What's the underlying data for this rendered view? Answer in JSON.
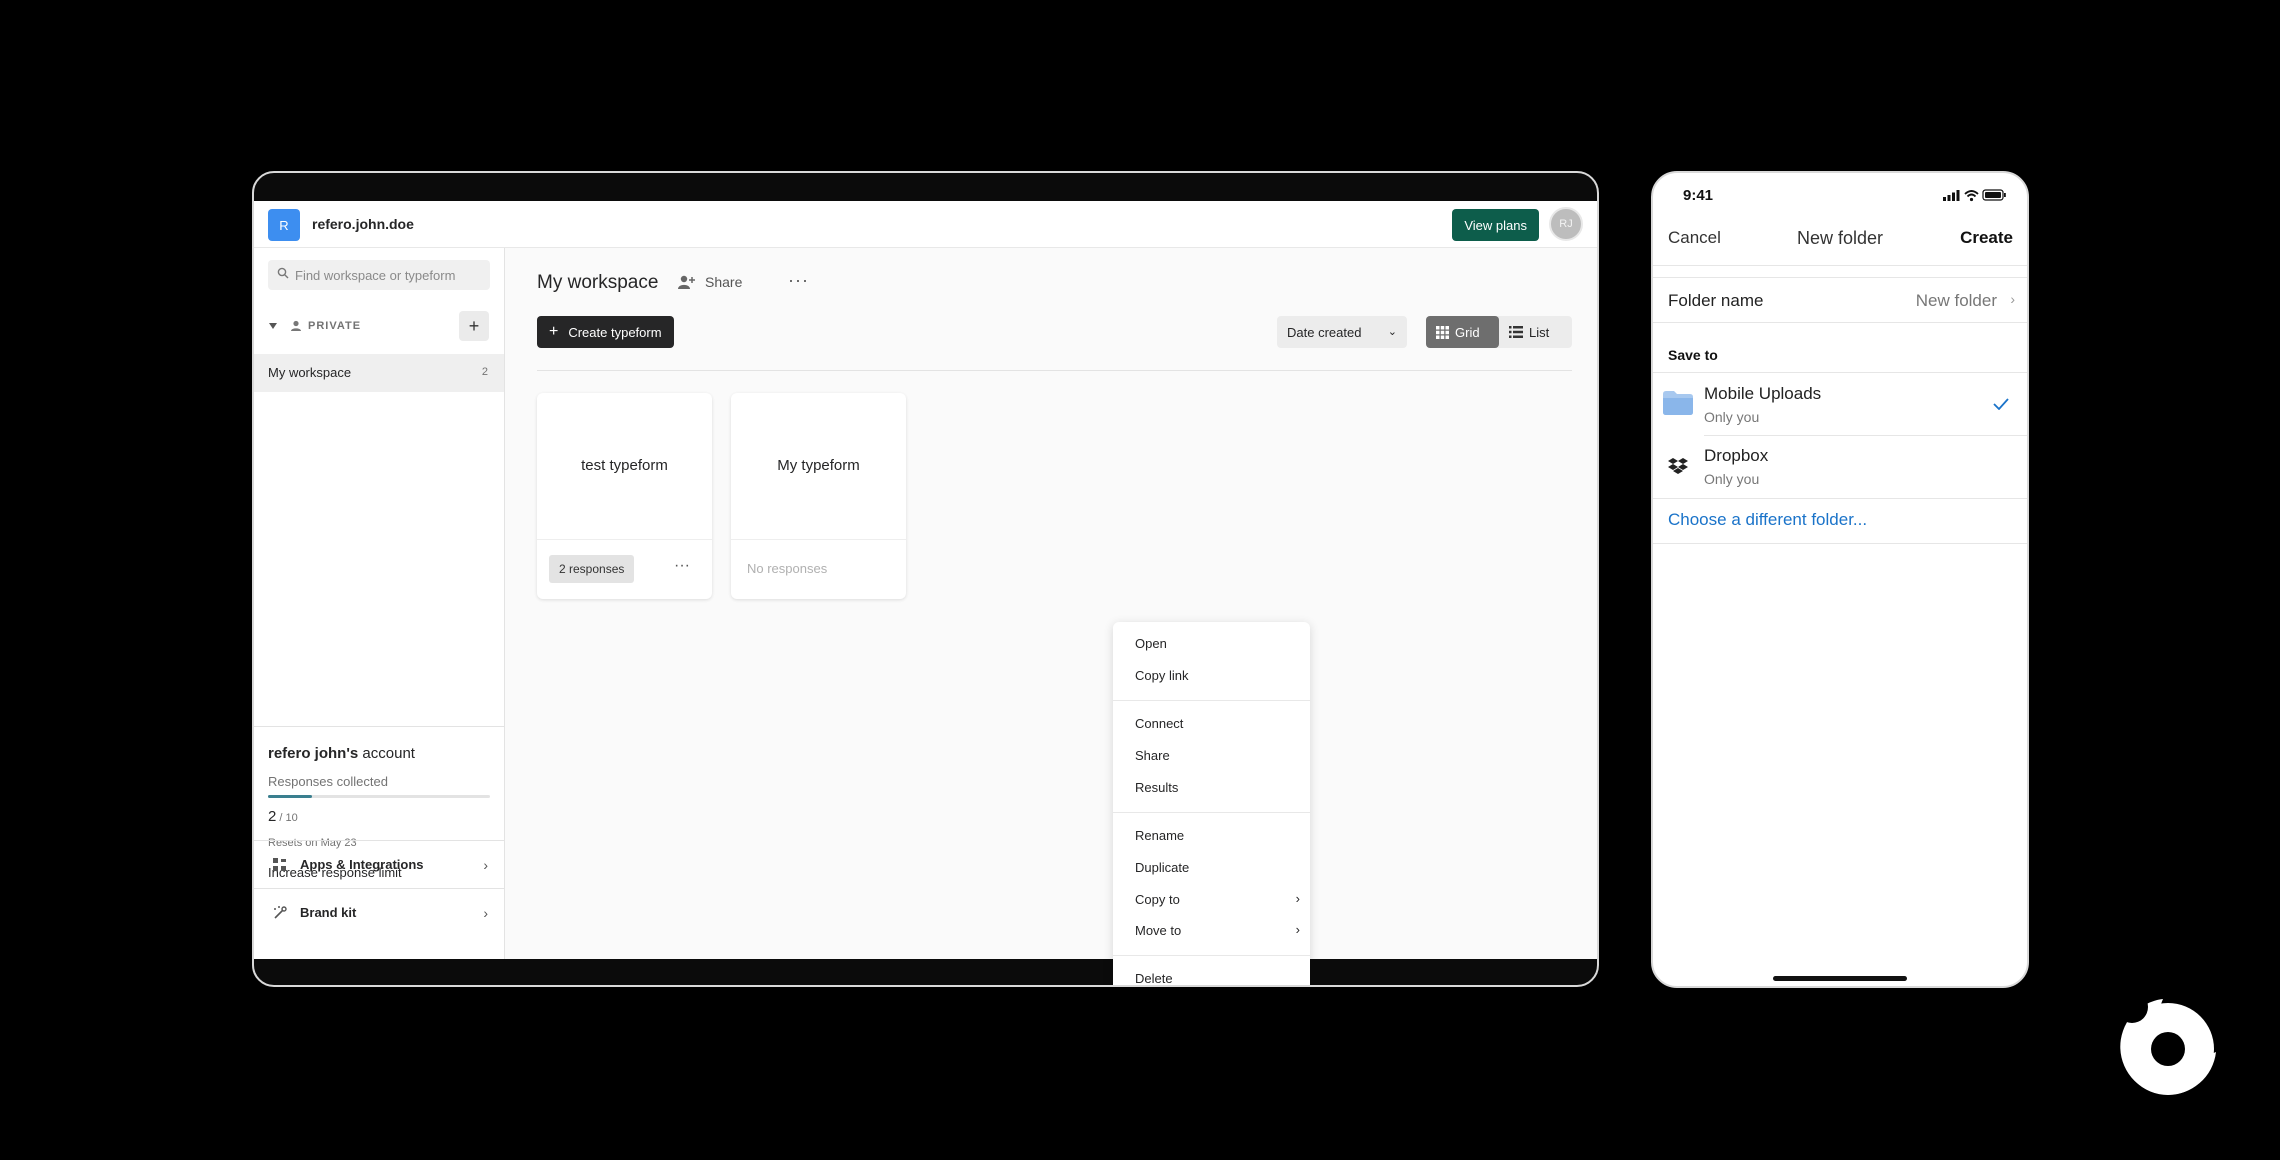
{
  "desktop": {
    "workspace_initial": "R",
    "workspace_name": "refero.john.doe",
    "view_plans_label": "View plans",
    "user_initials": "RJ",
    "search_placeholder": "Find workspace or typeform",
    "private_label": "PRIVATE",
    "workspace_item": {
      "label": "My workspace",
      "count": "2"
    },
    "account": {
      "title_bold": "refero john's",
      "title_rest": " account",
      "responses_label": "Responses collected",
      "progress_fraction": 0.2,
      "count": "2",
      "total": " / 10",
      "reset_text": "Resets on May 23",
      "increase_label": "Increase response limit"
    },
    "side_links": [
      {
        "label": "Apps & Integrations",
        "icon": "apps-icon"
      },
      {
        "label": "Brand kit",
        "icon": "brand-kit-icon"
      }
    ],
    "main": {
      "title": "My workspace",
      "share_label": "Share",
      "more_label": "···",
      "create_label": "Create typeform",
      "sort_label": "Date created",
      "grid_label": "Grid",
      "list_label": "List"
    },
    "cards": [
      {
        "title": "test typeform",
        "responses": "2 responses"
      },
      {
        "title": "My typeform",
        "responses": "No responses"
      }
    ],
    "context_menu": {
      "groups": [
        [
          "Open",
          "Copy link"
        ],
        [
          "Connect",
          "Share",
          "Results"
        ],
        [
          "Rename",
          "Duplicate",
          "Copy to",
          "Move to"
        ],
        [
          "Delete"
        ]
      ]
    }
  },
  "phone": {
    "time": "9:41",
    "cancel_label": "Cancel",
    "title": "New folder",
    "create_label": "Create",
    "folder_name_label": "Folder name",
    "folder_name_value": "New folder",
    "save_to_label": "Save to",
    "destinations": [
      {
        "title": "Mobile Uploads",
        "subtitle": "Only you",
        "selected": true
      },
      {
        "title": "Dropbox",
        "subtitle": "Only you",
        "selected": false
      }
    ],
    "choose_label": "Choose a different folder..."
  },
  "colors": {
    "accent_green": "#0d5d4b",
    "workspace_blue": "#3d8ef0",
    "link_blue": "#1a73c9"
  }
}
